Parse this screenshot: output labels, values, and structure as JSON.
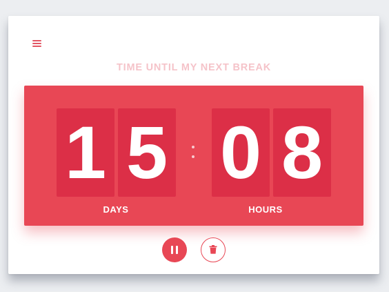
{
  "header": {
    "menu_icon": "hamburger-menu-icon",
    "title": "TIME UNTIL MY NEXT BREAK"
  },
  "countdown": {
    "days_digits": [
      "1",
      "5"
    ],
    "hours_digits": [
      "0",
      "8"
    ],
    "days_label": "DAYS",
    "hours_label": "HOURS",
    "separator_icon": "colon-separator"
  },
  "controls": {
    "pause_icon": "pause-icon",
    "delete_icon": "trash-icon"
  },
  "colors": {
    "accent": "#e84755",
    "digit_tile": "#dc2f47",
    "title_text": "#f5c3c9",
    "background": "#eceef1"
  }
}
